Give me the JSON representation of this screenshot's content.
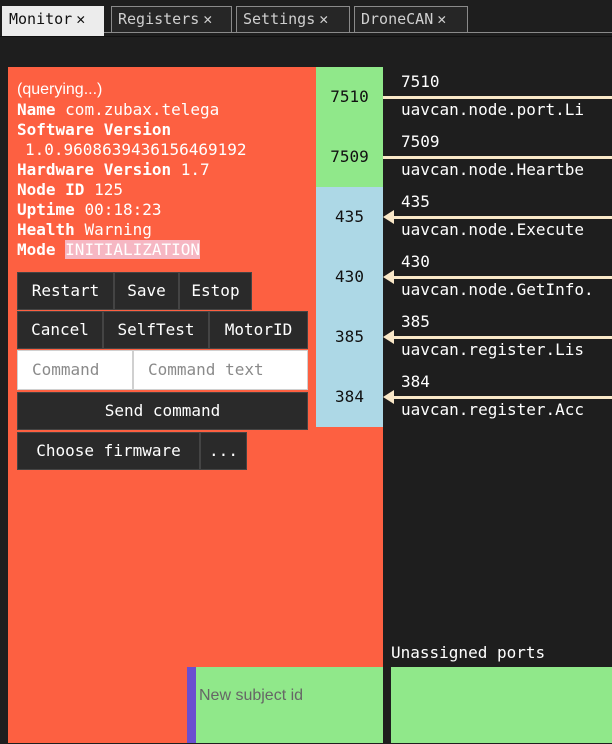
{
  "tabs": [
    {
      "label": "Monitor",
      "active": true
    },
    {
      "label": "Registers",
      "active": false
    },
    {
      "label": "Settings",
      "active": false
    },
    {
      "label": "DroneCAN",
      "active": false
    }
  ],
  "node": {
    "status_line": "(querying...)",
    "name_label": "Name",
    "name": "com.zubax.telega",
    "software_version_label": "Software Version",
    "software_version": "1.0.9608639436156469192",
    "hardware_version_label": "Hardware Version",
    "hardware_version": "1.7",
    "node_id_label": "Node ID",
    "node_id": "125",
    "uptime_label": "Uptime",
    "uptime": "00:18:23",
    "health_label": "Health",
    "health": "Warning",
    "mode_label": "Mode",
    "mode": "INITIALIZATION",
    "panel_color": "#fd6041"
  },
  "buttons": {
    "restart": "Restart",
    "save": "Save",
    "estop": "Estop",
    "cancel": "Cancel",
    "selftest": "SelfTest",
    "motorid": "MotorID",
    "send_command": "Send command",
    "choose_firmware": "Choose firmware",
    "more": "..."
  },
  "command": {
    "id_placeholder": "Command",
    "text_placeholder": "Command text"
  },
  "subject": {
    "placeholder": "New subject id"
  },
  "ports": [
    {
      "id": "7510",
      "kind": "publish",
      "color": "#90e88a",
      "name": "uavcan.node.port.Li"
    },
    {
      "id": "7509",
      "kind": "publish",
      "color": "#90e88a",
      "name": "uavcan.node.Heartbe"
    },
    {
      "id": "435",
      "kind": "server",
      "color": "#add8e6",
      "name": "uavcan.node.Execute"
    },
    {
      "id": "430",
      "kind": "server",
      "color": "#add8e6",
      "name": "uavcan.node.GetInfo."
    },
    {
      "id": "385",
      "kind": "server",
      "color": "#add8e6",
      "name": "uavcan.register.Lis"
    },
    {
      "id": "384",
      "kind": "server",
      "color": "#add8e6",
      "name": "uavcan.register.Acc"
    }
  ],
  "unassigned": {
    "label": "Unassigned ports"
  }
}
